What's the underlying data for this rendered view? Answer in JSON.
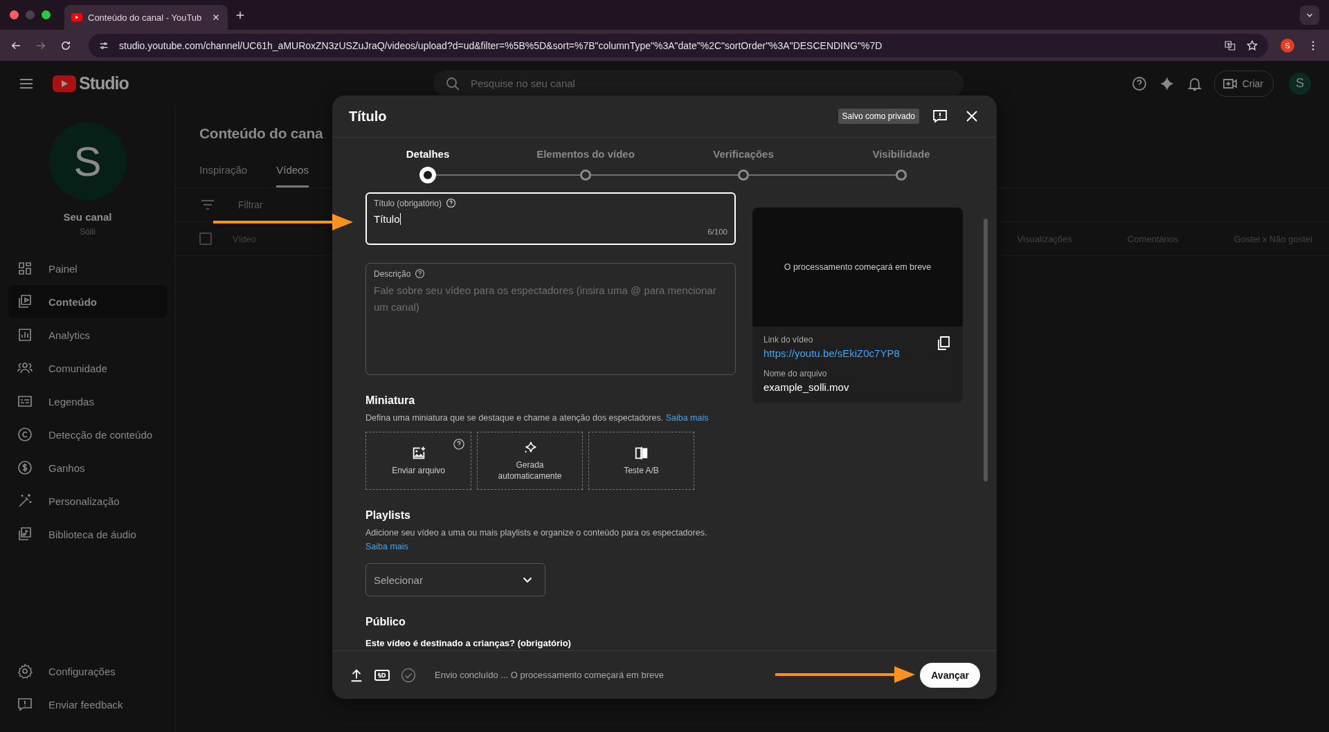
{
  "browser": {
    "tab_title": "Conteúdo do canal - YouTub",
    "url": "studio.youtube.com/channel/UC61h_aMURoxZN3zUSZuJraQ/videos/upload?d=ud&filter=%5B%5D&sort=%7B\"columnType\"%3A\"date\"%2C\"sortOrder\"%3A\"DESCENDING\"%7D",
    "profile_initial": "S"
  },
  "header": {
    "logo_text": "Studio",
    "search_placeholder": "Pesquise no seu canal",
    "create_label": "Criar",
    "avatar_initial": "S"
  },
  "sidebar": {
    "avatar_initial": "S",
    "channel_name": "Seu canal",
    "handle": "Sólli",
    "items": [
      {
        "label": "Painel",
        "selected": false
      },
      {
        "label": "Conteúdo",
        "selected": true
      },
      {
        "label": "Analytics",
        "selected": false
      },
      {
        "label": "Comunidade",
        "selected": false
      },
      {
        "label": "Legendas",
        "selected": false
      },
      {
        "label": "Detecção de conteúdo",
        "selected": false
      },
      {
        "label": "Ganhos",
        "selected": false
      },
      {
        "label": "Personalização",
        "selected": false
      },
      {
        "label": "Biblioteca de áudio",
        "selected": false
      }
    ],
    "bottom_items": [
      "Configurações",
      "Enviar feedback"
    ]
  },
  "content": {
    "title": "Conteúdo do cana",
    "tabs": [
      {
        "label": "Inspiração",
        "selected": false
      },
      {
        "label": "Vídeos",
        "selected": true
      }
    ],
    "filter_placeholder": "Filtrar",
    "select_all_checked": false,
    "columns": [
      "Vídeo",
      "Visualizações",
      "Comentários",
      "Gostei x Não gostei"
    ]
  },
  "dialog": {
    "title": "Título",
    "saved_badge": "Salvo como privado",
    "steps": [
      {
        "label": "Detalhes",
        "selected": true
      },
      {
        "label": "Elementos do vídeo",
        "selected": false
      },
      {
        "label": "Verificações",
        "selected": false
      },
      {
        "label": "Visibilidade",
        "selected": false
      }
    ],
    "title_field": {
      "label": "Título (obrigatório)",
      "value": "Título",
      "counter": "6/100"
    },
    "description_field": {
      "label": "Descrição",
      "placeholder": "Fale sobre seu vídeo para os espectadores (insira uma @ para mencionar um canal)"
    },
    "thumbnail": {
      "heading": "Miniatura",
      "text": "Defina uma miniatura que se destaque e chame a atenção dos espectadores.",
      "link": "Saiba mais",
      "options": [
        {
          "kind": "upload",
          "label": "Enviar arquivo",
          "help": true
        },
        {
          "kind": "auto",
          "label": "Gerada automaticamente",
          "help": false
        },
        {
          "kind": "abtest",
          "label": "Teste A/B",
          "help": false
        }
      ]
    },
    "playlists": {
      "heading": "Playlists",
      "text": "Adicione seu vídeo a uma ou mais playlists e organize o conteúdo para os espectadores.",
      "link": "Saiba mais",
      "select_placeholder": "Selecionar"
    },
    "audience": {
      "heading": "Público",
      "question": "Este vídeo é destinado a crianças? (obrigatório)"
    },
    "preview": {
      "status": "O processamento começará em breve",
      "link_label": "Link do vídeo",
      "link": "https://youtu.be/sEkiZ0c7YP8",
      "file_label": "Nome do arquivo",
      "file_name": "example_solli.mov"
    },
    "footer": {
      "status": "Envio concluído ... O processamento começará em breve",
      "next_button": "Avançar"
    }
  }
}
